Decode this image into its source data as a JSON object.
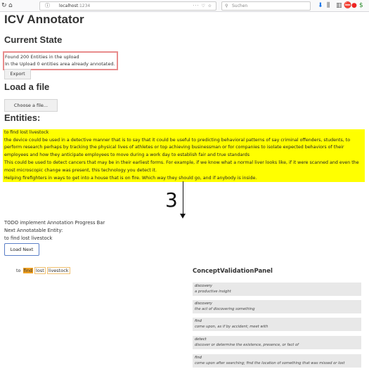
{
  "browser": {
    "url_host": "localhost",
    "url_port": ":1234",
    "search_placeholder": "Suchen"
  },
  "app_title": "ICV Annotator",
  "current_state": {
    "heading": "Current State",
    "line1": "Found 200 Entities in the upload",
    "line2": "In the Upload 0 entities area already annotated.",
    "export_label": "Export"
  },
  "load_file": {
    "heading": "Load a file",
    "choose_label": "Choose a file..."
  },
  "entities": {
    "heading": "Entities:",
    "lines": [
      "to find lost livestock",
      "the device could be used in a detective manner that is to say that it could be useful to predicting behavioral patterns of say criminal offenders, students, to",
      "perform research perhaps by tracking the physical lives of athletes or top achieving businessman or for companies to isolate expected behaviors of their",
      "employees and how they anticipate employees to move during a work day to establish fair and true standards",
      "This could be used to detect cancers that may be in their earliest forms. For example, if we know what a normal liver looks like, if it were scanned and even the",
      "most microscopic change was present, this technology you detect it.",
      "Helping firefighters in ways to get into a house that is on fire. Which way they should go, and if anybody is inside."
    ]
  },
  "annotation_marker": "3",
  "progress": {
    "todo": "TODO implement Annotation Progress Bar",
    "next_label": "Next Annotatable Entity:",
    "next_value": "to find lost livestock",
    "load_next_label": "Load Next"
  },
  "tokens": {
    "t1": "to",
    "t2": "find",
    "t3": "lost",
    "t4": "livestock"
  },
  "concept_panel": {
    "title": "ConceptValidationPanel",
    "cards": [
      {
        "word": "discovery",
        "definition": "a productive insight"
      },
      {
        "word": "discovery",
        "definition": "the act of discovering something"
      },
      {
        "word": "find",
        "definition": "come upon, as if by accident; meet with"
      },
      {
        "word": "detect",
        "definition": "discover or determine the existence, presence, or fact of"
      },
      {
        "word": "find",
        "definition": "come upon after searching; find the location of something that was missed or lost"
      }
    ]
  },
  "colors": {
    "highlight": "#ffff00",
    "active_token": "#f0a020",
    "state_border": "#e88c8c"
  }
}
